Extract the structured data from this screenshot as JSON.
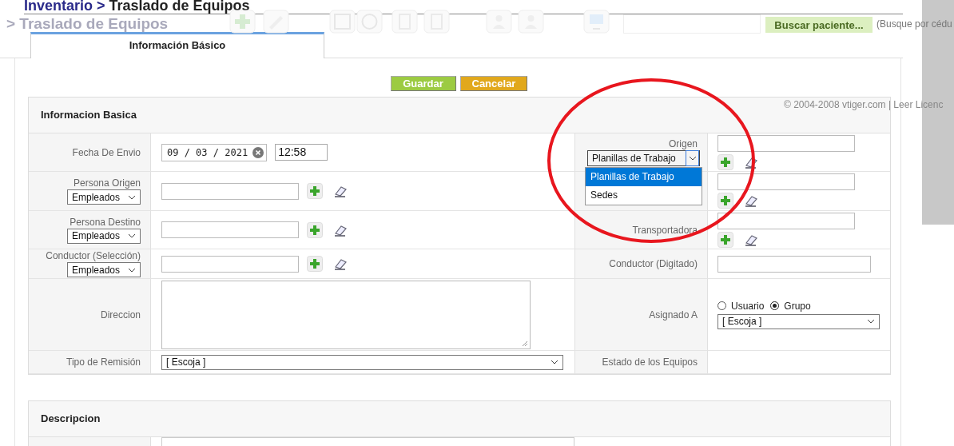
{
  "breadcrumb": {
    "module": "Inventario",
    "separator": ">",
    "page": "Traslado de Equipos"
  },
  "background": {
    "title": "> Traslado de Equipos",
    "search_button": "Buscar paciente...",
    "search_hint": "(Busque por cédu",
    "copyright": "© 2004-2008 vtiger.com | Leer Licenc"
  },
  "tabs": [
    {
      "label": "Información Básico",
      "selected": true
    }
  ],
  "buttons": [
    {
      "label": "Guardar",
      "kind": "save"
    },
    {
      "label": "Cancelar",
      "kind": "cancel"
    }
  ],
  "section": {
    "title": "Informacion Basica",
    "rows": [
      {
        "left": {
          "label": "Fecha De Envio",
          "kind": "date",
          "date": "09 / 03 / 2021",
          "time": "12:58"
        },
        "right": {
          "label": "Origen",
          "kind": "lookup",
          "type_select": "Planillas de Trabajo",
          "expanded": true,
          "options": [
            {
              "label": "Planillas de Trabajo",
              "selected": true
            },
            {
              "label": "Sedes",
              "selected": false
            }
          ]
        }
      },
      {
        "left": {
          "label": "Persona Origen",
          "kind": "lookup",
          "type_select": "Empleados"
        },
        "right": {
          "kind": "lookup"
        }
      },
      {
        "left": {
          "label": "Persona Destino",
          "kind": "lookup",
          "type_select": "Empleados"
        },
        "right": {
          "label": "Transportadora",
          "kind": "lookup"
        }
      },
      {
        "left": {
          "label": "Conductor (Selección)",
          "kind": "lookup",
          "type_select": "Empleados"
        },
        "right": {
          "label": "Conductor (Digitado)",
          "kind": "text"
        }
      },
      {
        "left": {
          "label": "Direccion",
          "kind": "textarea"
        },
        "right": {
          "label": "Asignado A",
          "kind": "assign",
          "radios": [
            {
              "label": "Usuario",
              "selected": false
            },
            {
              "label": "Grupo",
              "selected": true
            }
          ],
          "value": "[ Escoja ]"
        }
      },
      {
        "left": {
          "label": "Tipo de Remisión",
          "kind": "select",
          "value": "[ Escoja ]"
        },
        "right": {
          "label": "Estado de los Equipos",
          "kind": "empty"
        }
      }
    ]
  },
  "section2": {
    "title": "Descripcion"
  }
}
